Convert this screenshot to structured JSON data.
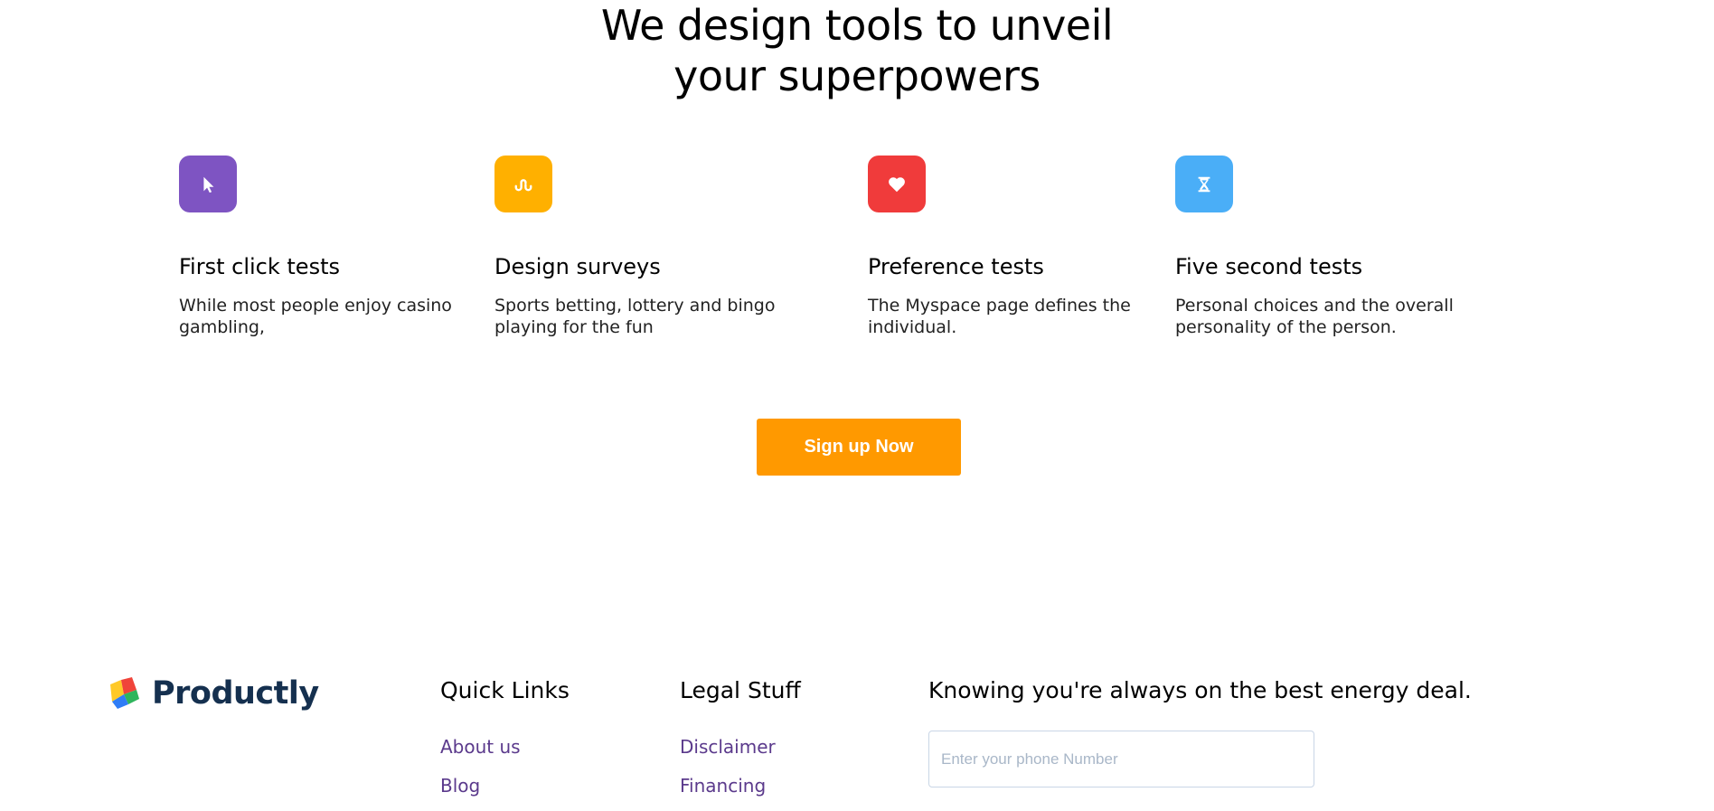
{
  "hero": {
    "title_line1": "We design tools to unveil",
    "title_line2": "your superpowers"
  },
  "features": [
    {
      "icon": "cursor-icon",
      "color": "#7e54c2",
      "title": "First click tests",
      "desc": "While most people enjoy casino gambling,"
    },
    {
      "icon": "stumbleupon-icon",
      "color": "#ffb000",
      "title": "Design surveys",
      "desc": "Sports betting, lottery and bingo playing for the fun"
    },
    {
      "icon": "heart-icon",
      "color": "#f03b3b",
      "title": "Preference tests",
      "desc": "The Myspace page defines the individual."
    },
    {
      "icon": "hourglass-icon",
      "color": "#4aaef7",
      "title": "Five second tests",
      "desc": "Personal choices and the overall personality of the person."
    }
  ],
  "cta": {
    "label": "Sign up Now",
    "color": "#ff9900"
  },
  "footer": {
    "brand": "Productly",
    "quick_links": {
      "title": "Quick Links",
      "items": [
        "About us",
        "Blog"
      ]
    },
    "legal": {
      "title": "Legal Stuff",
      "items": [
        "Disclaimer",
        "Financing"
      ]
    },
    "newsletter": {
      "title": "Knowing you're always on the best energy deal.",
      "placeholder": "Enter your phone Number",
      "value": ""
    }
  }
}
